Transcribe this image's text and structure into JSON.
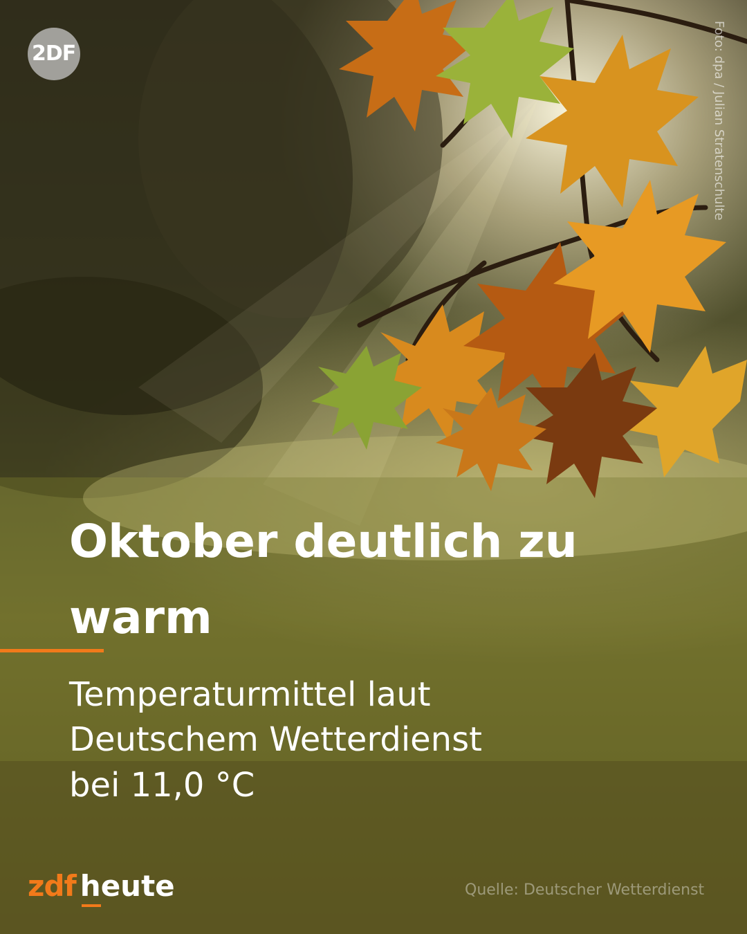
{
  "headline": "Oktober deutlich zu warm",
  "subline_1": "Temperaturmittel laut",
  "subline_2": "Deutschem Wetterdienst",
  "subline_3": "bei 11,0 °C",
  "corner_logo": "2DF",
  "photo_credit": "Foto: dpa / Julian Stratenschulte",
  "brand": {
    "left": "zdf",
    "right": "heute"
  },
  "source": "Quelle: Deutscher Wetterdienst",
  "colors": {
    "accent": "#f27a1a",
    "text": "#ffffff"
  },
  "image_description": ""
}
